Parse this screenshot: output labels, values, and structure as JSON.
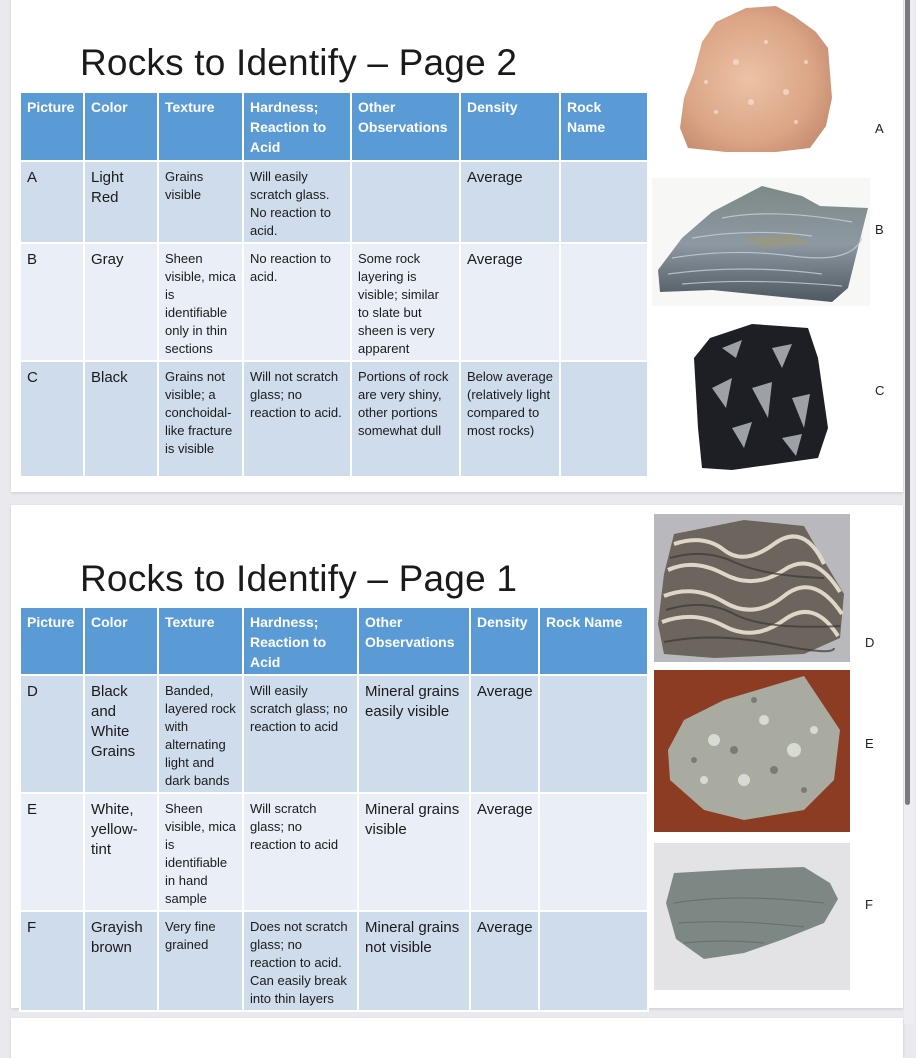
{
  "slides": [
    {
      "title": "Rocks to Identify – Page 2",
      "headers": [
        "Picture",
        "Color",
        "Texture",
        "Hardness; Reaction to Acid",
        "Other Observations",
        "Density",
        "Rock Name"
      ],
      "rows": [
        {
          "picture": "A",
          "color": "Light Red",
          "texture": "Grains visible",
          "hardness": "Will easily scratch glass. No reaction to acid.",
          "other": "",
          "density": "Average",
          "rock_name": ""
        },
        {
          "picture": "B",
          "color": "Gray",
          "texture": "Sheen visible, mica is identifiable only in thin sections",
          "hardness": "No reaction to acid.",
          "other": "Some rock layering is visible; similar to slate but sheen is very apparent",
          "density": "Average",
          "rock_name": ""
        },
        {
          "picture": "C",
          "color": "Black",
          "texture": "Grains not visible; a conchoidal-like fracture is visible",
          "hardness": "Will not scratch glass; no reaction to acid.",
          "other": "Portions of rock are very shiny, other portions somewhat dull",
          "density": "Below average (relatively light compared to most rocks)",
          "rock_name": ""
        }
      ],
      "images": [
        {
          "label": "A",
          "subject": "light red granular rock photo"
        },
        {
          "label": "B",
          "subject": "gray layered sheeny rock photo"
        },
        {
          "label": "C",
          "subject": "black shiny rock photo"
        }
      ]
    },
    {
      "title": "Rocks to Identify – Page 1",
      "headers": [
        "Picture",
        "Color",
        "Texture",
        "Hardness; Reaction to Acid",
        "Other Observations",
        "Density",
        "Rock Name"
      ],
      "rows": [
        {
          "picture": "D",
          "color": "Black and White Grains",
          "texture": "Banded, layered rock with alternating light and dark bands",
          "hardness": "Will easily scratch glass; no reaction to acid",
          "other": "Mineral grains easily visible",
          "density": "Average",
          "rock_name": ""
        },
        {
          "picture": "E",
          "color": "White, yellow-tint",
          "texture": "Sheen visible, mica is identifiable in hand sample",
          "hardness": "Will scratch glass; no reaction to acid",
          "other": "Mineral grains visible",
          "density": "Average",
          "rock_name": ""
        },
        {
          "picture": "F",
          "color": "Grayish brown",
          "texture": "Very fine grained",
          "hardness": "Does not scratch glass; no reaction to acid. Can easily break into thin layers",
          "other": "Mineral grains not visible",
          "density": "Average",
          "rock_name": ""
        }
      ],
      "images": [
        {
          "label": "D",
          "subject": "banded black and white rock photo"
        },
        {
          "label": "E",
          "subject": "white yellow-tint mica rock photo"
        },
        {
          "label": "F",
          "subject": "grayish fine grained rock photo"
        }
      ]
    }
  ],
  "colors": {
    "header_bg": "#5b9bd5",
    "row_odd": "#cfdcec",
    "row_even": "#e9eef7"
  }
}
